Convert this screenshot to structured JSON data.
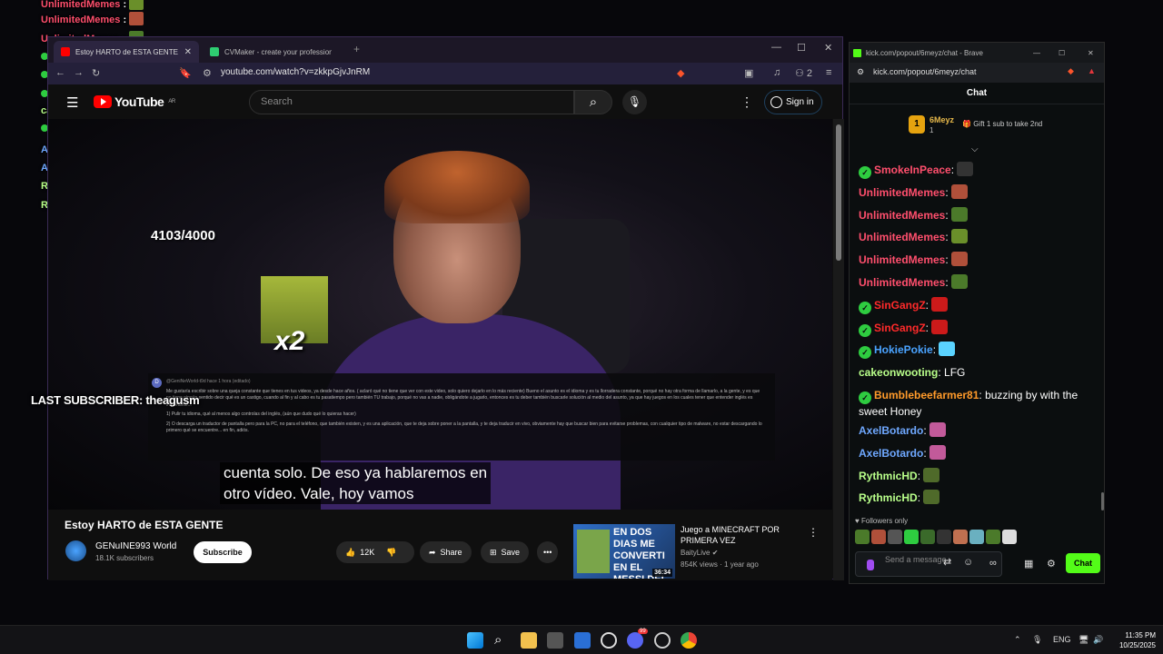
{
  "overlay_chat": [
    {
      "name": "UnlimitedMemes",
      "color": "#ff4f6d",
      "text": ":",
      "emote": "#6a8f2a",
      "top": 0,
      "mod": false
    },
    {
      "name": "UnlimitedMemes",
      "color": "#ff4f6d",
      "text": ":",
      "emote": "#b0503a",
      "top": 0,
      "mod": false
    },
    {
      "name": "UnlimitedMemes",
      "color": "#ff4f6d",
      "text": ":",
      "emote": "#4b7a2a",
      "top": 0,
      "mod": false
    },
    {
      "name": "SinGangZ",
      "color": "#ff2a2a",
      "text": ":",
      "emote": "#cc1a1a",
      "top": 0,
      "mod": true
    },
    {
      "name": "SinGangZ",
      "color": "#ff2a2a",
      "text": ":",
      "emote": "#cc1a1a",
      "top": 0,
      "mod": true
    },
    {
      "name": "HokiePokie",
      "color": "#4aa3ff",
      "text": ":",
      "emote": "#5ad3ff",
      "top": 0,
      "mod": true
    },
    {
      "name": "cakeonwooting",
      "color": "#b9ff8a",
      "text": ": LFG",
      "emote": "",
      "top": 0,
      "mod": false
    },
    {
      "name": "Bumblebeefarmer81",
      "color": "#ff9a2a",
      "text": ": buzzing by with the sweet Honey",
      "emote": "",
      "top": 0,
      "mod": true
    },
    {
      "name": "AxelBotardo",
      "color": "#6fa8ff",
      "text": ":",
      "emote": "#c25a9a",
      "top": 0,
      "mod": false
    },
    {
      "name": "AxelBotardo",
      "color": "#6fa8ff",
      "text": ":",
      "emote": "#c25a9a",
      "top": 0,
      "mod": false
    },
    {
      "name": "RythmicHD",
      "color": "#b9ff8a",
      "text": ":",
      "emote": "#4f6a2a",
      "top": 0,
      "mod": false
    },
    {
      "name": "RythmicHD",
      "color": "#b9ff8a",
      "text": ":",
      "emote": "#4f6a2a",
      "top": 0,
      "mod": false
    }
  ],
  "overlay": {
    "sub_count": "4103/4000",
    "multiplier": "x2",
    "last_subscriber": "LAST SUBSCRIBER: theagusm"
  },
  "browser": {
    "tab_active": "Estoy HARTO de ESTA GENTE",
    "tab_2": "CVMaker - create your professional",
    "url": "youtube.com/watch?v=zkkpGjvJnRM",
    "ext_count": "2"
  },
  "youtube": {
    "logo": "YouTube",
    "region": "AR",
    "search_placeholder": "Search",
    "sign_in": "Sign in",
    "subtitle_line1": "cuenta solo. De eso ya hablaremos en",
    "subtitle_line2": "otro vídeo. Vale, hoy vamos",
    "comment_author": "@GeniNeWorld-t9d hace 1 hora (editado)",
    "comment_p1": "Me gustaría escribir sobre una queja constante que tienes en tus videos, ya desde hace años. ( aclaró qué no tiene que ver con este video, solo quiero dejarlo en lo más reciente) Bueno el asunto es el idioma y es tu llorradera constante, porqué no hay otra forma de llamarlo, a la gente, y es que no tiene ningún sentido decir qué es un castigo, cuando al fin y al cabo es tu pasatiempo pero también TU trabajo, porqué no vas a nadie, obligándote a jugarlo, entonces es tu deber también buscarle solución al medio del asunto, ya que hay juegos en los cuales tener que entender inglés es importante...",
    "comment_p2": "1) Pulir tu idioma, qué al menos algo controlas del inglés, (aún que dudo qué lo quieras hacer)",
    "comment_p3": "2) O descarga un traductor de pantalla pero para la PC, no para el teléfono, que también existen, y es una aplicación, que te deja sobre poner a la pantalla, y te deja traducir en vivo, obviamente hay que buscar bien para evitarse problemas, con cualquier tipo de malware, no estar descargando lo primero qué se encuentre... en fin, adiós.",
    "video_title": "Estoy HARTO de ESTA GENTE",
    "channel_name": "GENuINE993 World",
    "channel_subs": "18.1K subscribers",
    "subscribe": "Subscribe",
    "likes": "12K",
    "share": "Share",
    "save": "Save",
    "rec_thumb_text": "EN DOS DIAS ME CONVERTI EN EL MESSI DEL MINECR",
    "rec_duration": "36:34",
    "rec_title": "Juego a MINECRAFT POR PRIMERA VEZ",
    "rec_channel": "BaityLive",
    "rec_meta": "854K views · 1 year ago"
  },
  "kick": {
    "window_title": "kick.com/popout/6meyz/chat - Brave",
    "url": "kick.com/popout/6meyz/chat",
    "header": "Chat",
    "pinned_rank": "1",
    "pinned_name": "6Meyz",
    "pinned_count": "1",
    "pinned_gift": "Gift 1 sub to take 2nd",
    "messages": [
      {
        "name": "SmokeInPeace",
        "color": "#ff4f6d",
        "mod": true,
        "text": "",
        "emote": "#333"
      },
      {
        "name": "UnlimitedMemes",
        "color": "#ff4f6d",
        "mod": false,
        "text": "",
        "emote": "#b0503a"
      },
      {
        "name": "UnlimitedMemes",
        "color": "#ff4f6d",
        "mod": false,
        "text": "",
        "emote": "#4b7a2a"
      },
      {
        "name": "UnlimitedMemes",
        "color": "#ff4f6d",
        "mod": false,
        "text": "",
        "emote": "#6a8f2a"
      },
      {
        "name": "UnlimitedMemes",
        "color": "#ff4f6d",
        "mod": false,
        "text": "",
        "emote": "#b0503a"
      },
      {
        "name": "UnlimitedMemes",
        "color": "#ff4f6d",
        "mod": false,
        "text": "",
        "emote": "#4b7a2a"
      },
      {
        "name": "SinGangZ",
        "color": "#ff2a2a",
        "mod": true,
        "text": "",
        "emote": "#cc1a1a"
      },
      {
        "name": "SinGangZ",
        "color": "#ff2a2a",
        "mod": true,
        "text": "",
        "emote": "#cc1a1a"
      },
      {
        "name": "HokiePokie",
        "color": "#4aa3ff",
        "mod": true,
        "text": "",
        "emote": "#5ad3ff"
      },
      {
        "name": "cakeonwooting",
        "color": "#b9ff8a",
        "mod": false,
        "text": " LFG",
        "emote": ""
      },
      {
        "name": "Bumblebeefarmer81",
        "color": "#ff9a2a",
        "mod": true,
        "text": " buzzing by with the sweet Honey",
        "emote": ""
      },
      {
        "name": "AxelBotardo",
        "color": "#6fa8ff",
        "mod": false,
        "text": "",
        "emote": "#c25a9a"
      },
      {
        "name": "AxelBotardo",
        "color": "#6fa8ff",
        "mod": false,
        "text": "",
        "emote": "#c25a9a"
      },
      {
        "name": "RythmicHD",
        "color": "#b9ff8a",
        "mod": false,
        "text": "",
        "emote": "#4f6a2a"
      },
      {
        "name": "RythmicHD",
        "color": "#b9ff8a",
        "mod": false,
        "text": "",
        "emote": "#4f6a2a"
      }
    ],
    "followers_only": "Followers only",
    "send_placeholder": "Send a message",
    "send": "Chat"
  },
  "taskbar": {
    "lang": "ENG",
    "time": "11:35 PM",
    "date": "10/25/2025",
    "discord_badge": "99"
  }
}
